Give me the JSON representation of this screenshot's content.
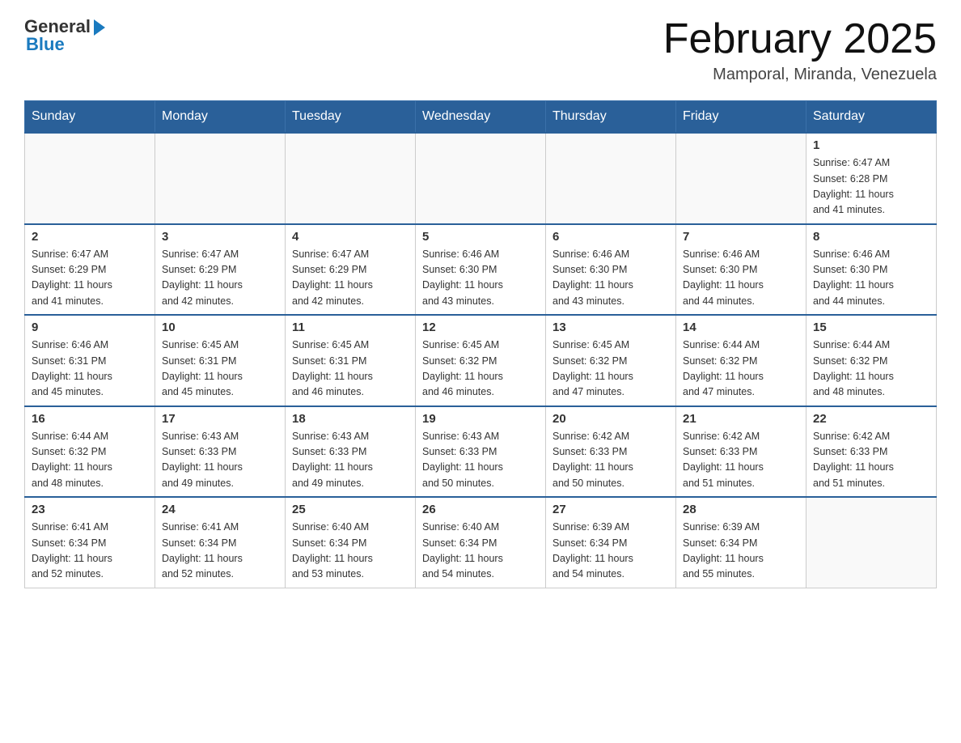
{
  "header": {
    "logo_general": "General",
    "logo_blue": "Blue",
    "month_title": "February 2025",
    "location": "Mamporal, Miranda, Venezuela"
  },
  "weekdays": [
    "Sunday",
    "Monday",
    "Tuesday",
    "Wednesday",
    "Thursday",
    "Friday",
    "Saturday"
  ],
  "weeks": [
    {
      "days": [
        {
          "num": "",
          "info": ""
        },
        {
          "num": "",
          "info": ""
        },
        {
          "num": "",
          "info": ""
        },
        {
          "num": "",
          "info": ""
        },
        {
          "num": "",
          "info": ""
        },
        {
          "num": "",
          "info": ""
        },
        {
          "num": "1",
          "info": "Sunrise: 6:47 AM\nSunset: 6:28 PM\nDaylight: 11 hours\nand 41 minutes."
        }
      ]
    },
    {
      "days": [
        {
          "num": "2",
          "info": "Sunrise: 6:47 AM\nSunset: 6:29 PM\nDaylight: 11 hours\nand 41 minutes."
        },
        {
          "num": "3",
          "info": "Sunrise: 6:47 AM\nSunset: 6:29 PM\nDaylight: 11 hours\nand 42 minutes."
        },
        {
          "num": "4",
          "info": "Sunrise: 6:47 AM\nSunset: 6:29 PM\nDaylight: 11 hours\nand 42 minutes."
        },
        {
          "num": "5",
          "info": "Sunrise: 6:46 AM\nSunset: 6:30 PM\nDaylight: 11 hours\nand 43 minutes."
        },
        {
          "num": "6",
          "info": "Sunrise: 6:46 AM\nSunset: 6:30 PM\nDaylight: 11 hours\nand 43 minutes."
        },
        {
          "num": "7",
          "info": "Sunrise: 6:46 AM\nSunset: 6:30 PM\nDaylight: 11 hours\nand 44 minutes."
        },
        {
          "num": "8",
          "info": "Sunrise: 6:46 AM\nSunset: 6:30 PM\nDaylight: 11 hours\nand 44 minutes."
        }
      ]
    },
    {
      "days": [
        {
          "num": "9",
          "info": "Sunrise: 6:46 AM\nSunset: 6:31 PM\nDaylight: 11 hours\nand 45 minutes."
        },
        {
          "num": "10",
          "info": "Sunrise: 6:45 AM\nSunset: 6:31 PM\nDaylight: 11 hours\nand 45 minutes."
        },
        {
          "num": "11",
          "info": "Sunrise: 6:45 AM\nSunset: 6:31 PM\nDaylight: 11 hours\nand 46 minutes."
        },
        {
          "num": "12",
          "info": "Sunrise: 6:45 AM\nSunset: 6:32 PM\nDaylight: 11 hours\nand 46 minutes."
        },
        {
          "num": "13",
          "info": "Sunrise: 6:45 AM\nSunset: 6:32 PM\nDaylight: 11 hours\nand 47 minutes."
        },
        {
          "num": "14",
          "info": "Sunrise: 6:44 AM\nSunset: 6:32 PM\nDaylight: 11 hours\nand 47 minutes."
        },
        {
          "num": "15",
          "info": "Sunrise: 6:44 AM\nSunset: 6:32 PM\nDaylight: 11 hours\nand 48 minutes."
        }
      ]
    },
    {
      "days": [
        {
          "num": "16",
          "info": "Sunrise: 6:44 AM\nSunset: 6:32 PM\nDaylight: 11 hours\nand 48 minutes."
        },
        {
          "num": "17",
          "info": "Sunrise: 6:43 AM\nSunset: 6:33 PM\nDaylight: 11 hours\nand 49 minutes."
        },
        {
          "num": "18",
          "info": "Sunrise: 6:43 AM\nSunset: 6:33 PM\nDaylight: 11 hours\nand 49 minutes."
        },
        {
          "num": "19",
          "info": "Sunrise: 6:43 AM\nSunset: 6:33 PM\nDaylight: 11 hours\nand 50 minutes."
        },
        {
          "num": "20",
          "info": "Sunrise: 6:42 AM\nSunset: 6:33 PM\nDaylight: 11 hours\nand 50 minutes."
        },
        {
          "num": "21",
          "info": "Sunrise: 6:42 AM\nSunset: 6:33 PM\nDaylight: 11 hours\nand 51 minutes."
        },
        {
          "num": "22",
          "info": "Sunrise: 6:42 AM\nSunset: 6:33 PM\nDaylight: 11 hours\nand 51 minutes."
        }
      ]
    },
    {
      "days": [
        {
          "num": "23",
          "info": "Sunrise: 6:41 AM\nSunset: 6:34 PM\nDaylight: 11 hours\nand 52 minutes."
        },
        {
          "num": "24",
          "info": "Sunrise: 6:41 AM\nSunset: 6:34 PM\nDaylight: 11 hours\nand 52 minutes."
        },
        {
          "num": "25",
          "info": "Sunrise: 6:40 AM\nSunset: 6:34 PM\nDaylight: 11 hours\nand 53 minutes."
        },
        {
          "num": "26",
          "info": "Sunrise: 6:40 AM\nSunset: 6:34 PM\nDaylight: 11 hours\nand 54 minutes."
        },
        {
          "num": "27",
          "info": "Sunrise: 6:39 AM\nSunset: 6:34 PM\nDaylight: 11 hours\nand 54 minutes."
        },
        {
          "num": "28",
          "info": "Sunrise: 6:39 AM\nSunset: 6:34 PM\nDaylight: 11 hours\nand 55 minutes."
        },
        {
          "num": "",
          "info": ""
        }
      ]
    }
  ]
}
